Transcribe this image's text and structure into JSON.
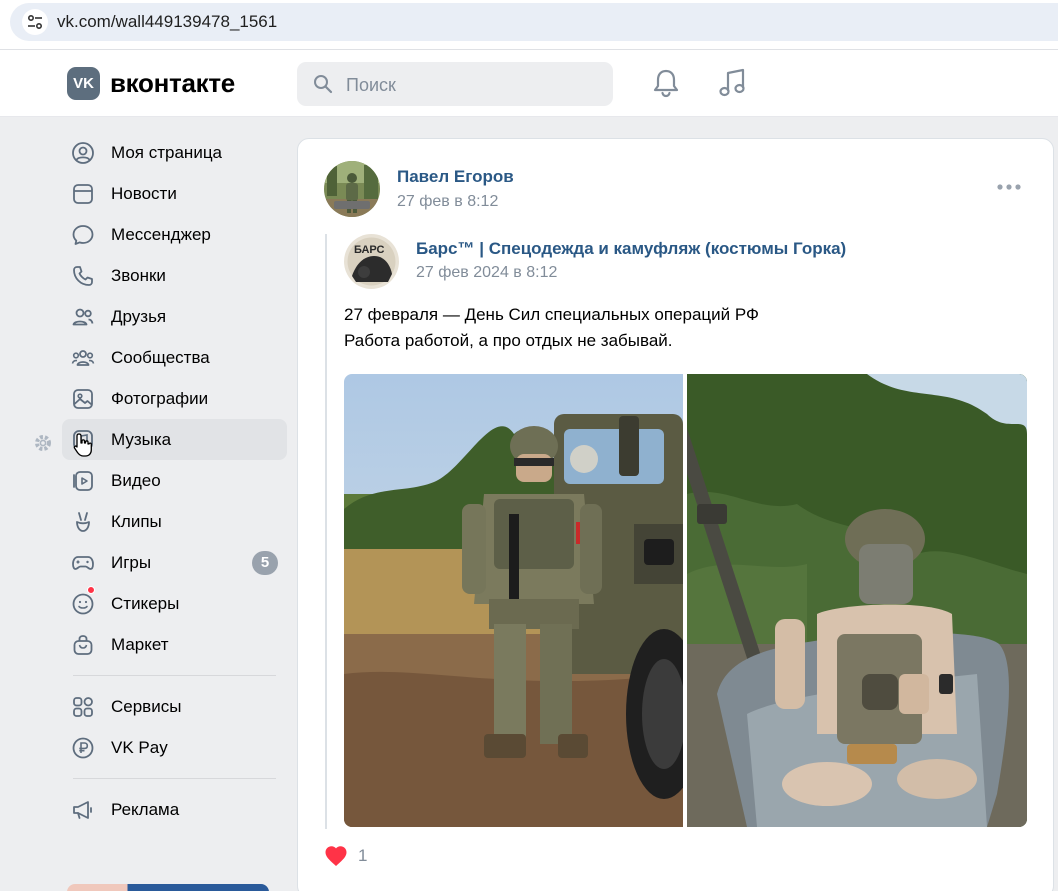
{
  "browser": {
    "url": "vk.com/wall449139478_1561",
    "site_icon": "tune-icon"
  },
  "header": {
    "logo_text": "вконтакте",
    "logo_mark": "VK",
    "search_placeholder": "Поиск",
    "icons": [
      "bell-icon",
      "music-note-icon"
    ]
  },
  "sidebar": {
    "items": [
      {
        "label": "Моя страница",
        "icon": "user-circle-icon"
      },
      {
        "label": "Новости",
        "icon": "news-icon"
      },
      {
        "label": "Мессенджер",
        "icon": "message-icon"
      },
      {
        "label": "Звонки",
        "icon": "phone-icon"
      },
      {
        "label": "Друзья",
        "icon": "friends-icon"
      },
      {
        "label": "Сообщества",
        "icon": "communities-icon"
      },
      {
        "label": "Фотографии",
        "icon": "photo-icon"
      },
      {
        "label": "Музыка",
        "icon": "music-icon"
      },
      {
        "label": "Видео",
        "icon": "video-icon"
      },
      {
        "label": "Клипы",
        "icon": "clips-icon"
      },
      {
        "label": "Игры",
        "icon": "gamepad-icon",
        "badge": "5"
      },
      {
        "label": "Стикеры",
        "icon": "sticker-icon"
      },
      {
        "label": "Маркет",
        "icon": "market-icon"
      }
    ],
    "secondary": [
      {
        "label": "Сервисы",
        "icon": "services-icon"
      },
      {
        "label": "VK Pay",
        "icon": "ruble-icon"
      }
    ],
    "tertiary": [
      {
        "label": "Реклама",
        "icon": "megaphone-icon"
      }
    ]
  },
  "post": {
    "author": "Павел Егоров",
    "date": "27 фев в 8:12",
    "repost": {
      "group": "Барс™ | Спецодежда и камуфляж (костюмы Горка)",
      "group_avatar_text": "БАРС",
      "date": "27 фев 2024 в 8:12",
      "text_lines": [
        "27 февраля — День Сил специальных операций РФ",
        "Работа работой, а про отдых не забывай."
      ]
    },
    "likes": "1"
  },
  "colors": {
    "link": "#2a5885",
    "secondary_text": "#818c99",
    "like_red": "#ff3347",
    "page_bg": "#edeef0"
  }
}
